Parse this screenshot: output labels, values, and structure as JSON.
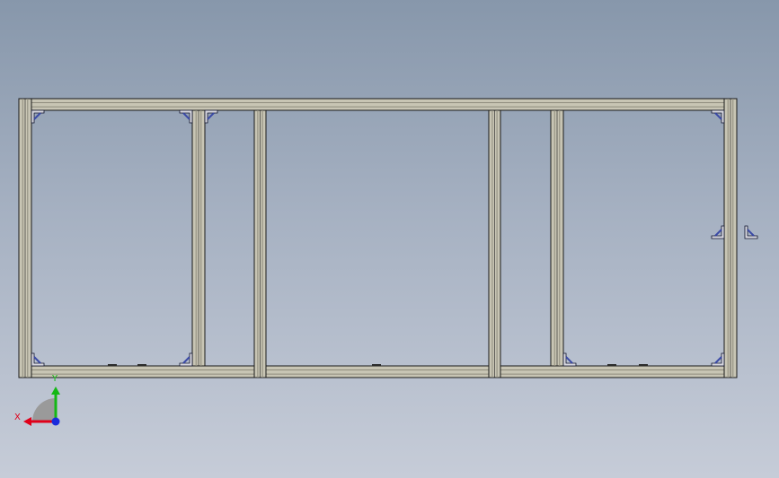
{
  "viewport": {
    "background_top": "#8797ab",
    "background_bottom": "#c6ccd8"
  },
  "frame": {
    "profile_fill": "#c8c5b4",
    "profile_shadow": "#8e8b7c",
    "profile_stroke": "#1a1a1a",
    "bracket_fill": "#3b4aa6",
    "bracket_stroke": "#0b0f2a"
  },
  "triad": {
    "x_label": "X",
    "y_label": "Y",
    "x_color": "#e0001a",
    "y_color": "#14b814",
    "z_color": "#1a2bdc",
    "sector_color": "#9a9a9a",
    "x_icon": "x-axis-arrow-icon",
    "y_icon": "y-axis-arrow-icon",
    "z_icon": "z-axis-dot-icon"
  }
}
